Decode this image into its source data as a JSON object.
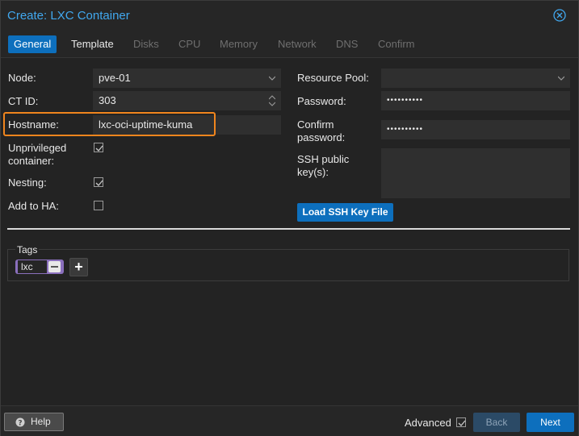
{
  "window": {
    "title": "Create: LXC Container"
  },
  "tabs": [
    {
      "label": "General",
      "state": "active"
    },
    {
      "label": "Template",
      "state": "enabled"
    },
    {
      "label": "Disks",
      "state": "disabled"
    },
    {
      "label": "CPU",
      "state": "disabled"
    },
    {
      "label": "Memory",
      "state": "disabled"
    },
    {
      "label": "Network",
      "state": "disabled"
    },
    {
      "label": "DNS",
      "state": "disabled"
    },
    {
      "label": "Confirm",
      "state": "disabled"
    }
  ],
  "left": {
    "node_label": "Node:",
    "node_value": "pve-01",
    "ctid_label": "CT ID:",
    "ctid_value": "303",
    "hostname_label": "Hostname:",
    "hostname_value": "lxc-oci-uptime-kuma",
    "unprivileged_label": "Unprivileged container:",
    "unprivileged_checked": true,
    "nesting_label": "Nesting:",
    "nesting_checked": true,
    "ha_label": "Add to HA:",
    "ha_checked": false
  },
  "right": {
    "pool_label": "Resource Pool:",
    "pool_value": "",
    "password_label": "Password:",
    "password_value": "••••••••••",
    "confirm_label": "Confirm password:",
    "confirm_value": "••••••••••",
    "ssh_label": "SSH public key(s):",
    "ssh_value": "",
    "load_ssh_label": "Load SSH Key File"
  },
  "tags": {
    "label": "Tags",
    "items": [
      "lxc"
    ],
    "add_label": "+"
  },
  "footer": {
    "help_label": "Help",
    "advanced_label": "Advanced",
    "advanced_checked": true,
    "back_label": "Back",
    "next_label": "Next"
  },
  "colors": {
    "accent": "#0d6fbd",
    "title": "#41a8ef",
    "highlight": "#f0851d",
    "tag": "#8a6fbd"
  }
}
